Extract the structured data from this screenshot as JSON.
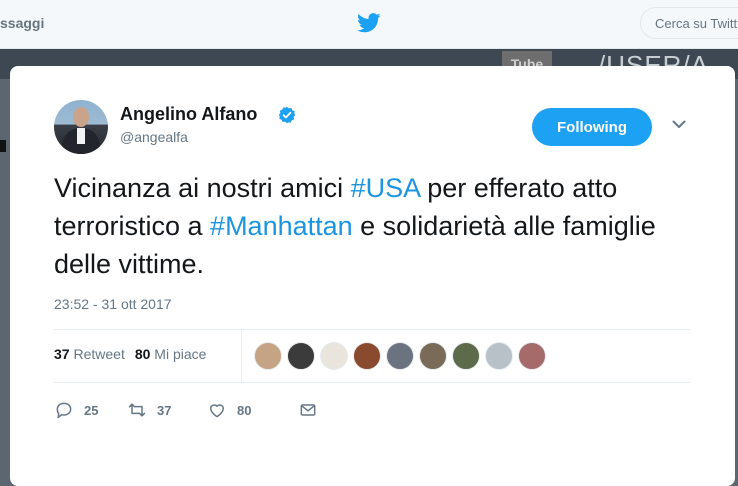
{
  "topbar": {
    "messages_label": "ssaggi",
    "search_placeholder": "Cerca su Twitt"
  },
  "background": {
    "youtube_text": "Tube",
    "user_text": "/USER/A"
  },
  "tweet": {
    "author_name": "Angelino Alfano",
    "handle": "@angealfa",
    "follow_button_label": "Following",
    "text_parts": {
      "p1": "Vicinanza ai nostri amici ",
      "h1": "#USA",
      "p2": " per efferato atto terroristico a ",
      "h2": "#Manhattan",
      "p3": " e solidarietà alle famiglie delle vittime."
    },
    "timestamp": "23:52 - 31 ott 2017",
    "retweets_count": "37",
    "retweets_label": "Retweet",
    "likes_count": "80",
    "likes_label": "Mi piace",
    "likers": [
      {
        "name": "liker-1",
        "color": "#c4a484"
      },
      {
        "name": "liker-2",
        "color": "#3b3b3b"
      },
      {
        "name": "liker-3",
        "color": "#e9e4dc"
      },
      {
        "name": "liker-4",
        "color": "#8a4a2e"
      },
      {
        "name": "liker-5",
        "color": "#6b7280"
      },
      {
        "name": "liker-6",
        "color": "#7a6a58"
      },
      {
        "name": "liker-7",
        "color": "#5d6b4a"
      },
      {
        "name": "liker-8",
        "color": "#b8c0c8"
      },
      {
        "name": "liker-9",
        "color": "#a56b6b"
      }
    ],
    "actions": {
      "reply_count": "25",
      "retweet_count": "37",
      "like_count": "80"
    }
  },
  "colors": {
    "accent": "#1da1f2",
    "hashtag": "#1b95e0",
    "text": "#14171a",
    "muted": "#657786"
  }
}
